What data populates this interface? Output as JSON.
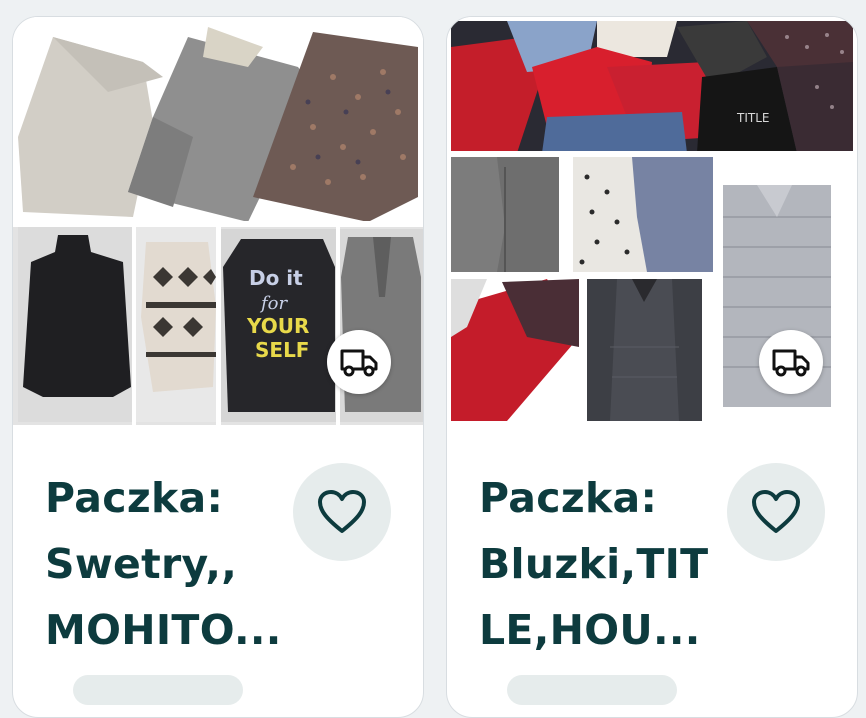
{
  "listings": [
    {
      "title_lines": [
        "Paczka:",
        "Swetry,,",
        "MOHITO..."
      ],
      "photo_text": [
        "Do it",
        "for",
        "YOUR",
        "SELF"
      ],
      "favorite_icon": "heart-outline-icon",
      "shipping_icon": "delivery-truck-icon"
    },
    {
      "title_lines": [
        "Paczka:",
        "Bluzki,TIT",
        "LE,HOU..."
      ],
      "photo_text": [
        "TITLE"
      ],
      "favorite_icon": "heart-outline-icon",
      "shipping_icon": "delivery-truck-icon"
    }
  ],
  "colors": {
    "title": "#0d3b3e",
    "favorite_bg": "#e6ecec",
    "page_bg": "#eef1f3"
  }
}
